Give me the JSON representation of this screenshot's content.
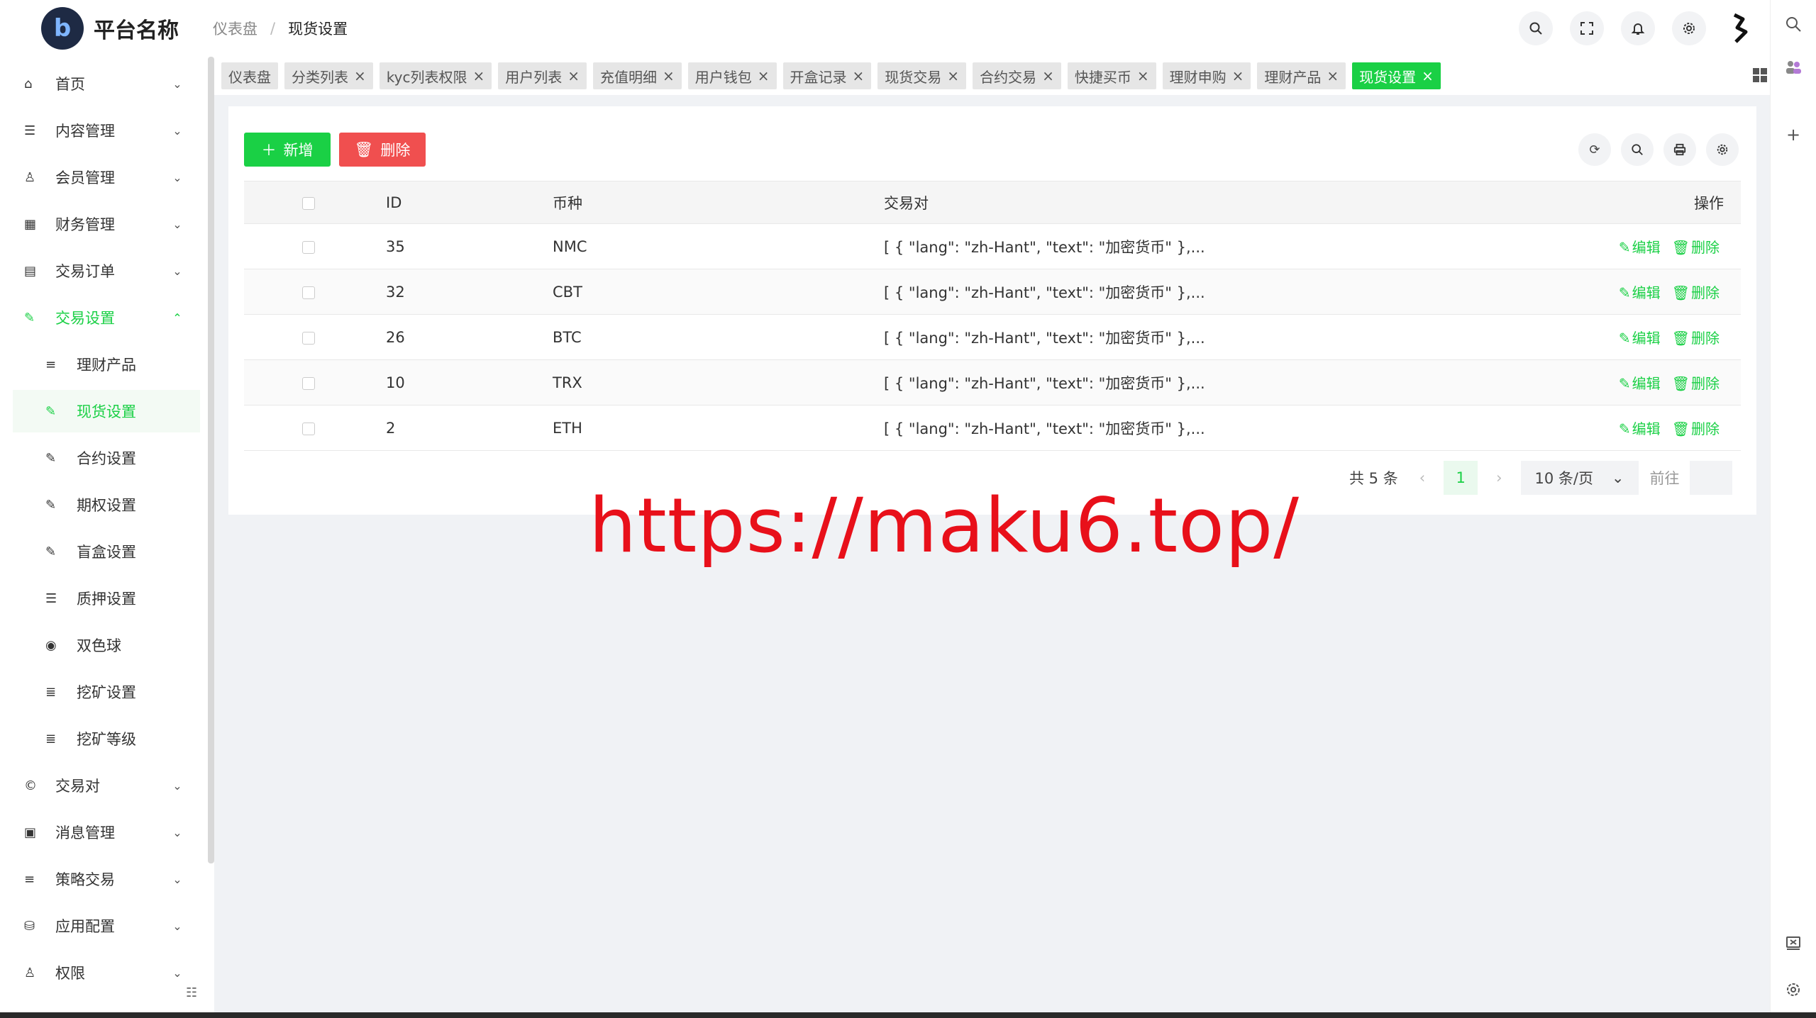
{
  "app": {
    "title": "平台名称",
    "logo_letter": "b"
  },
  "breadcrumb": {
    "root": "仪表盘",
    "separator": "/",
    "current": "现货设置"
  },
  "sidebar": {
    "items": [
      {
        "label": "首页",
        "icon": "⌂",
        "arrow": "⌄"
      },
      {
        "label": "内容管理",
        "icon": "☰",
        "arrow": "⌄"
      },
      {
        "label": "会员管理",
        "icon": "♙",
        "arrow": "⌄"
      },
      {
        "label": "财务管理",
        "icon": "▦",
        "arrow": "⌄"
      },
      {
        "label": "交易订单",
        "icon": "▤",
        "arrow": "⌄"
      },
      {
        "label": "交易设置",
        "icon": "✎",
        "arrow": "⌃"
      },
      {
        "label": "理财产品",
        "icon": "≡"
      },
      {
        "label": "现货设置",
        "icon": "✎"
      },
      {
        "label": "合约设置",
        "icon": "✎"
      },
      {
        "label": "期权设置",
        "icon": "✎"
      },
      {
        "label": "盲盒设置",
        "icon": "✎"
      },
      {
        "label": "质押设置",
        "icon": "☰"
      },
      {
        "label": "双色球",
        "icon": "◉"
      },
      {
        "label": "挖矿设置",
        "icon": "≣"
      },
      {
        "label": "挖矿等级",
        "icon": "≣"
      },
      {
        "label": "交易对",
        "icon": "©",
        "arrow": "⌄"
      },
      {
        "label": "消息管理",
        "icon": "▣",
        "arrow": "⌄"
      },
      {
        "label": "策略交易",
        "icon": "≡",
        "arrow": "⌄"
      },
      {
        "label": "应用配置",
        "icon": "⛁",
        "arrow": "⌄"
      },
      {
        "label": "权限",
        "icon": "♙",
        "arrow": "⌄"
      }
    ]
  },
  "tabs": [
    {
      "label": "仪表盘"
    },
    {
      "label": "分类列表"
    },
    {
      "label": "kyc列表权限"
    },
    {
      "label": "用户列表"
    },
    {
      "label": "充值明细"
    },
    {
      "label": "用户钱包"
    },
    {
      "label": "开盒记录"
    },
    {
      "label": "现货交易"
    },
    {
      "label": "合约交易"
    },
    {
      "label": "快捷买币"
    },
    {
      "label": "理财申购"
    },
    {
      "label": "理财产品"
    },
    {
      "label": "现货设置"
    }
  ],
  "toolbar": {
    "add_label": "新增",
    "delete_label": "删除"
  },
  "table": {
    "headers": {
      "id": "ID",
      "coin": "币种",
      "pair": "交易对",
      "actions": "操作"
    },
    "rows": [
      {
        "id": "35",
        "coin": "NMC",
        "pair": "[ { \"lang\": \"zh-Hant\", \"text\": \"加密货币\" },...",
        "edit": "编辑",
        "delete": "删除"
      },
      {
        "id": "32",
        "coin": "CBT",
        "pair": "[ { \"lang\": \"zh-Hant\", \"text\": \"加密货币\" },...",
        "edit": "编辑",
        "delete": "删除"
      },
      {
        "id": "26",
        "coin": "BTC",
        "pair": "[ { \"lang\": \"zh-Hant\", \"text\": \"加密货币\" },...",
        "edit": "编辑",
        "delete": "删除"
      },
      {
        "id": "10",
        "coin": "TRX",
        "pair": "[ { \"lang\": \"zh-Hant\", \"text\": \"加密货币\" },...",
        "edit": "编辑",
        "delete": "删除"
      },
      {
        "id": "2",
        "coin": "ETH",
        "pair": "[ { \"lang\": \"zh-Hant\", \"text\": \"加密货币\" },...",
        "edit": "编辑",
        "delete": "删除"
      }
    ]
  },
  "pagination": {
    "total": "共 5 条",
    "current_page": "1",
    "page_size": "10 条/页",
    "goto": "前往"
  },
  "watermark": "https://maku6.top/",
  "colors": {
    "accent": "#1ad045",
    "danger": "#f04f4f"
  }
}
